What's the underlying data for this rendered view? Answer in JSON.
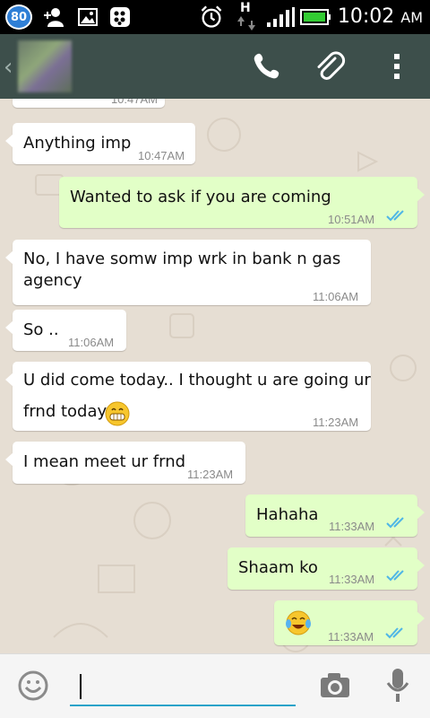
{
  "status_bar": {
    "notification_count": "80",
    "time": "10:02",
    "ampm": "AM",
    "network_letter": "H"
  },
  "action_bar": {
    "icons": [
      "back-chevron-icon",
      "avatar",
      "phone-icon",
      "paperclip-icon",
      "overflow-menu-icon"
    ]
  },
  "messages": [
    {
      "dir": "in",
      "text": "Anything imp",
      "time": "10:47AM"
    },
    {
      "dir": "out",
      "text": "Wanted to ask if you are coming",
      "time": "10:51AM",
      "ticks": "read"
    },
    {
      "dir": "in",
      "text_line1": "No, I have somw imp wrk in bank n gas",
      "text_line2": "agency",
      "time": "11:06AM"
    },
    {
      "dir": "in",
      "text": "So ..",
      "time": "11:06AM"
    },
    {
      "dir": "in",
      "text_line1": "U did come today.. I thought u are going ur",
      "text_line2": "frnd today",
      "time": "11:23AM"
    },
    {
      "dir": "in",
      "text": "I mean meet ur frnd",
      "time": "11:23AM"
    },
    {
      "dir": "out",
      "text": "Hahaha",
      "time": "11:33AM",
      "ticks": "read"
    },
    {
      "dir": "out",
      "text": "Shaam ko",
      "time": "11:33AM",
      "ticks": "read"
    },
    {
      "dir": "out",
      "emoji": "laughing-tears",
      "time": "11:33AM",
      "ticks": "read"
    }
  ],
  "partial_top_time": "10:47AM",
  "input_bar": {
    "placeholder": "",
    "value": ""
  },
  "colors": {
    "action_bar": "#3d4f4b",
    "outgoing_bubble": "#e2ffc7",
    "incoming_bubble": "#ffffff",
    "read_ticks": "#4fb6e6",
    "chat_background": "#e6ded3"
  }
}
